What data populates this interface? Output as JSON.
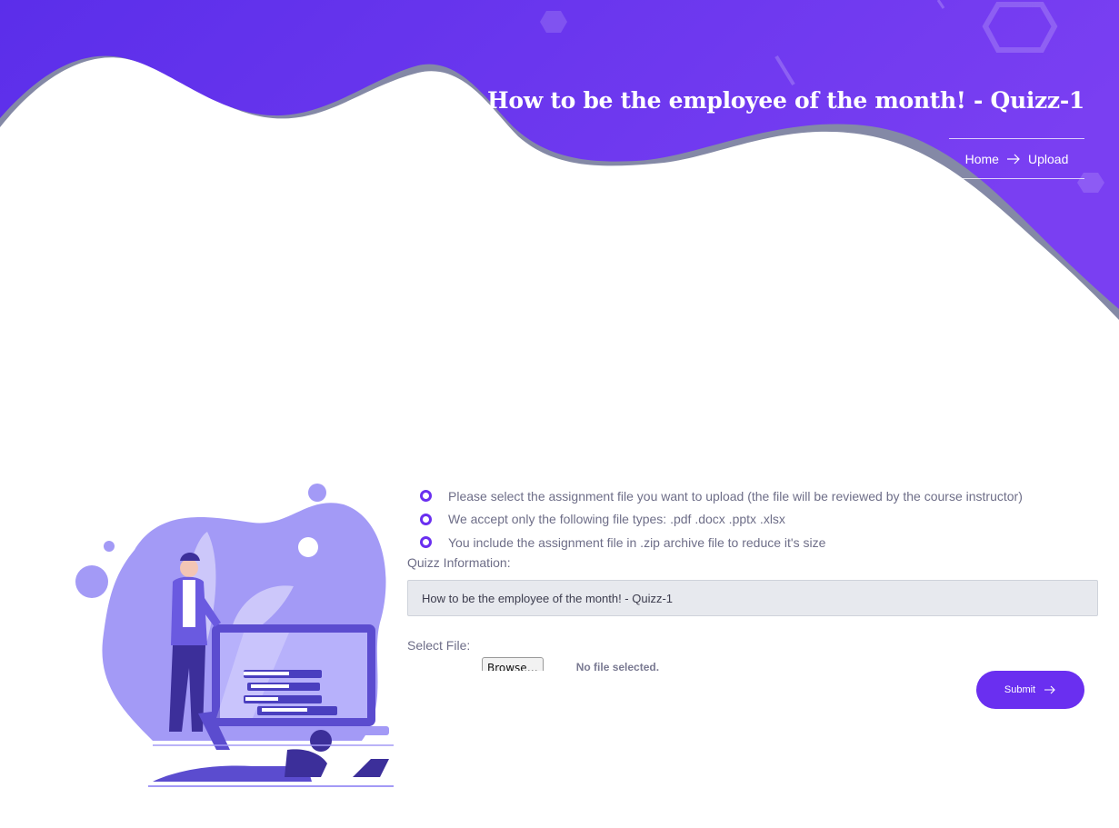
{
  "header": {
    "title": "How to be the employee of the month! - Quizz-1",
    "breadcrumb": {
      "home": "Home",
      "current": "Upload"
    }
  },
  "upload": {
    "rules": [
      "Please select the assignment file you want to upload (the file will be reviewed by the course instructor)",
      "We accept only the following file types: .pdf .docx .pptx .xlsx",
      "You include the assignment file in .zip archive file to reduce it's size"
    ],
    "info_label": "Quizz Information:",
    "info_value": "How to be the employee of the month! - Quizz-1",
    "file_label": "Select File:",
    "browse_label": "Browse…",
    "file_status": "No file selected.",
    "submit_label": "Submit"
  },
  "icons": {
    "breadcrumb_separator": "arrow-right-icon",
    "submit": "arrow-right-icon",
    "rule_bullet": "ring-bullet-icon"
  },
  "colors": {
    "brand": "#6a2ff0",
    "hero_start": "#5b2eea",
    "hero_end": "#7a3ff2",
    "illustration": "#a39af6"
  }
}
